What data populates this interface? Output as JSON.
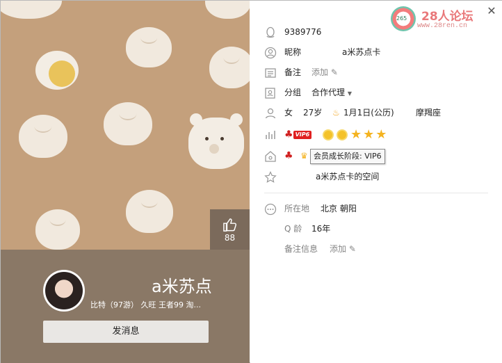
{
  "window": {
    "close_glyph": "✕"
  },
  "watermark": {
    "site_name": "28人论坛",
    "site_url": "www.28ren.cn",
    "badge_text": "265"
  },
  "cover": {
    "like_count": "88"
  },
  "profile": {
    "display_name": "a米苏点",
    "sub_info": "比特（97游） 久旺 王者99 淘...",
    "send_button": "发消息"
  },
  "details": {
    "qq_number": "9389776",
    "nickname_label": "昵称",
    "nickname_value": "a米苏点卡",
    "remark_label": "备注",
    "remark_add": "添加",
    "group_label": "分组",
    "group_value": "合作代理",
    "gender": "女",
    "age": "27岁",
    "birthday": "1月1日(公历)",
    "zodiac": "摩羯座",
    "vip_tag": "VIP6",
    "tooltip": "会员成长阶段: VIP6",
    "space_name": "a米苏点卡的空间",
    "location_label": "所在地",
    "location_value": "北京 朝阳",
    "qage_label": "Q 龄",
    "qage_value": "16年",
    "remark_info_label": "备注信息",
    "remark_info_add": "添加"
  },
  "colors": {
    "cover_bg": "#c4a07c",
    "panel_bg": "#8a7866",
    "vip_red": "#e02020",
    "star_gold": "#f4b320"
  }
}
